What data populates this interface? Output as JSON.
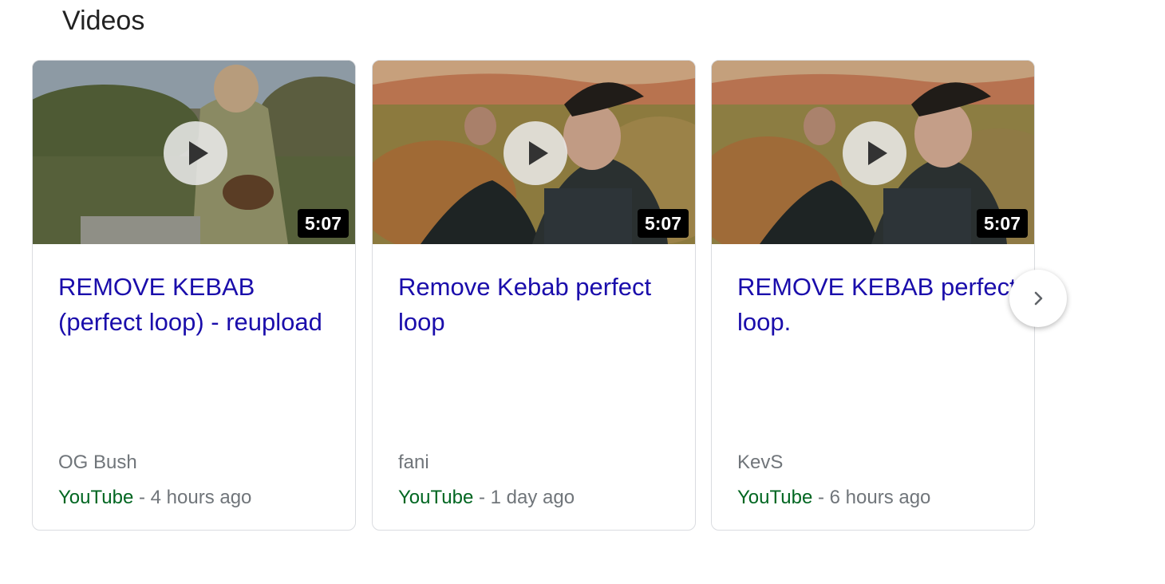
{
  "section": {
    "title": "Videos"
  },
  "videos": [
    {
      "title": "REMOVE KEBAB (perfect loop) - reupload",
      "duration": "5:07",
      "channel": "OG Bush",
      "source": "YouTube",
      "separator": " - ",
      "age": "4 hours ago"
    },
    {
      "title": "Remove Kebab perfect loop",
      "duration": "5:07",
      "channel": "fani",
      "source": "YouTube",
      "separator": " - ",
      "age": "1 day ago"
    },
    {
      "title": "REMOVE KEBAB perfect loop.",
      "duration": "5:07",
      "channel": "KevS",
      "source": "YouTube",
      "separator": " - ",
      "age": "6 hours ago"
    }
  ],
  "icons": {
    "play": "play-icon",
    "next": "chevron-right-icon"
  },
  "colors": {
    "link": "#1a0dab",
    "source": "#006621",
    "meta": "#70757a",
    "border": "#dadce0"
  }
}
